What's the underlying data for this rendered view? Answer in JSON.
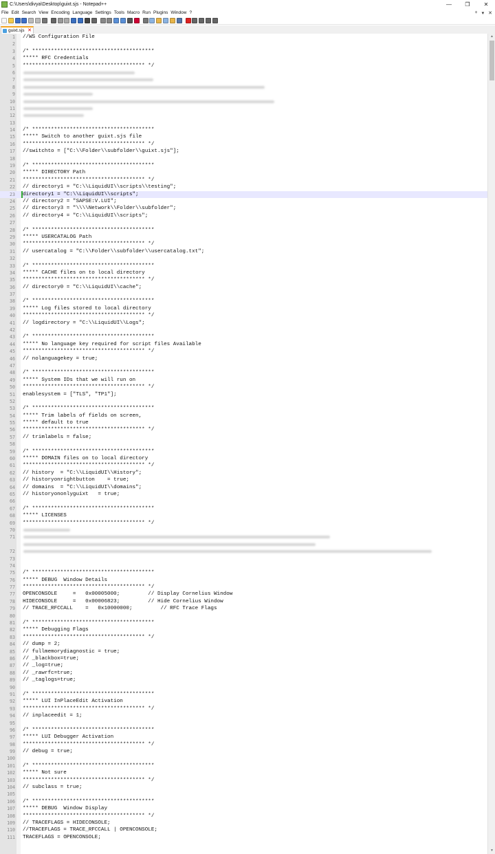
{
  "window": {
    "title": "C:\\Users\\divya\\Desktop\\guixt.sjs - Notepad++",
    "minimize_glyph": "—",
    "restore_glyph": "❐",
    "close_glyph": "✕"
  },
  "menu": {
    "items": [
      "File",
      "Edit",
      "Search",
      "View",
      "Encoding",
      "Language",
      "Settings",
      "Tools",
      "Macro",
      "Run",
      "Plugins",
      "Window",
      "?"
    ],
    "right_items": [
      "+",
      "▾",
      "✕"
    ]
  },
  "toolbar": {
    "icons": [
      "new-file-icon",
      "open-file-icon",
      "save-icon",
      "save-all-icon",
      "close-icon",
      "close-all-icon",
      "print-icon",
      "cut-icon",
      "copy-icon",
      "paste-icon",
      "undo-icon",
      "redo-icon",
      "find-icon",
      "replace-icon",
      "zoom-in-icon",
      "zoom-out-icon",
      "sync-vertical-icon",
      "sync-horizontal-icon",
      "word-wrap-icon",
      "show-all-chars-icon",
      "indent-guide-icon",
      "language-icon",
      "doc-map-icon",
      "function-list-icon",
      "folder-workspace-icon",
      "monitor-icon",
      "record-macro-icon",
      "stop-macro-icon",
      "play-macro-icon",
      "run-macro-multiple-icon",
      "save-macro-icon"
    ]
  },
  "tabs": [
    {
      "label": "guixt.sjs",
      "close_glyph": "✕"
    }
  ],
  "scrollbar": {
    "up_glyph": "▲",
    "down_glyph": "▼"
  },
  "colors": {
    "current_line": "#e8e8ff",
    "change_marker": "#33aa33",
    "tab_accent": "#f5a623"
  },
  "editor": {
    "current_line": 23,
    "changed_line": 23,
    "lines": [
      {
        "n": "1",
        "t": "//WS Configuration File"
      },
      {
        "n": "2",
        "t": ""
      },
      {
        "n": "3",
        "t": "/* ***************************************"
      },
      {
        "n": "4",
        "t": "***** RFC Credentials"
      },
      {
        "n": "5",
        "t": "*************************************** */"
      },
      {
        "n": "6",
        "t": "",
        "blur": 0.24
      },
      {
        "n": "7",
        "t": "",
        "blur": 0.28
      },
      {
        "n": "8",
        "t": "",
        "blur": 0.52
      },
      {
        "n": "9",
        "t": "",
        "blur": 0.15
      },
      {
        "n": "10",
        "t": "",
        "blur": 0.54
      },
      {
        "n": "11",
        "t": "",
        "blur": 0.15
      },
      {
        "n": "12",
        "t": "",
        "blur": 0.13
      },
      {
        "n": "13",
        "t": ""
      },
      {
        "n": "14",
        "t": "/* ***************************************"
      },
      {
        "n": "15",
        "t": "***** Switch to another guixt.sjs file"
      },
      {
        "n": "16",
        "t": "*************************************** */"
      },
      {
        "n": "17",
        "t": "//switchto = [\"C:\\\\Folder\\\\subfolder\\\\guixt.sjs\"];"
      },
      {
        "n": "18",
        "t": ""
      },
      {
        "n": "19",
        "t": "/* ***************************************"
      },
      {
        "n": "20",
        "t": "***** DIRECTORY Path"
      },
      {
        "n": "21",
        "t": "*************************************** */"
      },
      {
        "n": "22",
        "t": "// directory1 = \"C:\\\\LiquidUI\\\\scripts\\\\testing\";"
      },
      {
        "n": "23",
        "t": "directory1 = \"C:\\\\LiquidUI\\\\scripts\";"
      },
      {
        "n": "24",
        "t": "// directory2 = \"SAPSE:V.LUI\";"
      },
      {
        "n": "25",
        "t": "// directory3 = \"\\\\\\\\Network\\\\Folder\\\\subfolder\";"
      },
      {
        "n": "26",
        "t": "// directory4 = \"C:\\\\LiquidUI\\\\scripts\";"
      },
      {
        "n": "27",
        "t": ""
      },
      {
        "n": "28",
        "t": "/* ***************************************"
      },
      {
        "n": "29",
        "t": "***** USERCATALOG Path"
      },
      {
        "n": "30",
        "t": "*************************************** */"
      },
      {
        "n": "31",
        "t": "// usercatalog = \"C:\\\\Folder\\\\subfolder\\\\usercatalog.txt\";"
      },
      {
        "n": "32",
        "t": ""
      },
      {
        "n": "33",
        "t": "/* ***************************************"
      },
      {
        "n": "34",
        "t": "***** CACHE files on to local directory"
      },
      {
        "n": "35",
        "t": "*************************************** */"
      },
      {
        "n": "36",
        "t": "// directory0 = \"C:\\\\LiquidUI\\\\cache\";"
      },
      {
        "n": "37",
        "t": ""
      },
      {
        "n": "38",
        "t": "/* ***************************************"
      },
      {
        "n": "39",
        "t": "***** Log files stored to local directory"
      },
      {
        "n": "40",
        "t": "*************************************** */"
      },
      {
        "n": "41",
        "t": "// logdirectory = \"C:\\\\LiquidUI\\\\Logs\";"
      },
      {
        "n": "42",
        "t": ""
      },
      {
        "n": "43",
        "t": "/* ***************************************"
      },
      {
        "n": "44",
        "t": "***** No language key required for script files Available"
      },
      {
        "n": "45",
        "t": "*************************************** */"
      },
      {
        "n": "46",
        "t": "// nolanguagekey = true;"
      },
      {
        "n": "47",
        "t": ""
      },
      {
        "n": "48",
        "t": "/* ***************************************"
      },
      {
        "n": "49",
        "t": "***** System IDs that we will run on"
      },
      {
        "n": "50",
        "t": "*************************************** */"
      },
      {
        "n": "51",
        "t": "enablesystem = [\"TLS\", \"TP1\"];"
      },
      {
        "n": "52",
        "t": ""
      },
      {
        "n": "53",
        "t": "/* ***************************************"
      },
      {
        "n": "54",
        "t": "***** Trim labels of fields on screen,"
      },
      {
        "n": "55",
        "t": "***** default to true"
      },
      {
        "n": "56",
        "t": "*************************************** */"
      },
      {
        "n": "57",
        "t": "// trimlabels = false;"
      },
      {
        "n": "58",
        "t": ""
      },
      {
        "n": "59",
        "t": "/* ***************************************"
      },
      {
        "n": "60",
        "t": "***** DOMAIN files on to local directory"
      },
      {
        "n": "61",
        "t": "*************************************** */"
      },
      {
        "n": "62",
        "t": "// history  = \"C:\\\\LiquidUI\\\\History\";"
      },
      {
        "n": "63",
        "t": "// historyonrightbutton    = true;"
      },
      {
        "n": "64",
        "t": "// domains  = \"C:\\\\LiquidUI\\\\domains\";"
      },
      {
        "n": "65",
        "t": "// historyononlyguixt   = true;"
      },
      {
        "n": "66",
        "t": ""
      },
      {
        "n": "67",
        "t": "/* ***************************************"
      },
      {
        "n": "68",
        "t": "***** LICENSES"
      },
      {
        "n": "69",
        "t": "*************************************** */"
      },
      {
        "n": "70",
        "t": "",
        "blur": 0.1
      },
      {
        "n": "71",
        "t": "",
        "blur": 0.66
      },
      {
        "n": "",
        "t": "",
        "blur": 0.63
      },
      {
        "n": "72",
        "t": "",
        "blur": 0.88
      },
      {
        "n": "73",
        "t": ""
      },
      {
        "n": "74",
        "t": ""
      },
      {
        "n": "75",
        "t": "/* ***************************************"
      },
      {
        "n": "76",
        "t": "***** DEBUG  Window Details"
      },
      {
        "n": "77",
        "t": "*************************************** */"
      },
      {
        "n": "77",
        "t": "OPENCONSOLE     =   0x00005000;         // Display Cornelius Window"
      },
      {
        "n": "78",
        "t": "HIDECONSOLE     =   0x00006823;         // Hide Cornelius Window"
      },
      {
        "n": "79",
        "t": "// TRACE_RFCCALL    =   0x10000000;         // RFC Trace Flags"
      },
      {
        "n": "80",
        "t": ""
      },
      {
        "n": "81",
        "t": "/* ***************************************"
      },
      {
        "n": "82",
        "t": "***** Debugging Flags"
      },
      {
        "n": "83",
        "t": "*************************************** */"
      },
      {
        "n": "84",
        "t": "// dump = 2;"
      },
      {
        "n": "85",
        "t": "// fullmemorydiagnostic = true;"
      },
      {
        "n": "86",
        "t": "// _blackbox=true;"
      },
      {
        "n": "87",
        "t": "// _log=true;"
      },
      {
        "n": "88",
        "t": "// _rawrfc=true;"
      },
      {
        "n": "89",
        "t": "// _taglogs=true;"
      },
      {
        "n": "90",
        "t": ""
      },
      {
        "n": "91",
        "t": "/* ***************************************"
      },
      {
        "n": "92",
        "t": "***** LUI InPlaceEdit Activation"
      },
      {
        "n": "93",
        "t": "*************************************** */"
      },
      {
        "n": "94",
        "t": "// inplaceedit = 1;"
      },
      {
        "n": "95",
        "t": ""
      },
      {
        "n": "96",
        "t": "/* ***************************************"
      },
      {
        "n": "97",
        "t": "***** LUI Debugger Activation"
      },
      {
        "n": "98",
        "t": "*************************************** */"
      },
      {
        "n": "99",
        "t": "// debug = true;"
      },
      {
        "n": "100",
        "t": ""
      },
      {
        "n": "101",
        "t": "/* ***************************************"
      },
      {
        "n": "102",
        "t": "***** Not sure"
      },
      {
        "n": "103",
        "t": "*************************************** */"
      },
      {
        "n": "104",
        "t": "// subclass = true;"
      },
      {
        "n": "105",
        "t": ""
      },
      {
        "n": "106",
        "t": "/* ***************************************"
      },
      {
        "n": "107",
        "t": "***** DEBUG  Window Display"
      },
      {
        "n": "108",
        "t": "*************************************** */"
      },
      {
        "n": "109",
        "t": "// TRACEFLAGS = HIDECONSOLE;"
      },
      {
        "n": "110",
        "t": "//TRACEFLAGS = TRACE_RFCCALL | OPENCONSOLE;"
      },
      {
        "n": "111",
        "t": "TRACEFLAGS = OPENCONSOLE;"
      }
    ]
  }
}
